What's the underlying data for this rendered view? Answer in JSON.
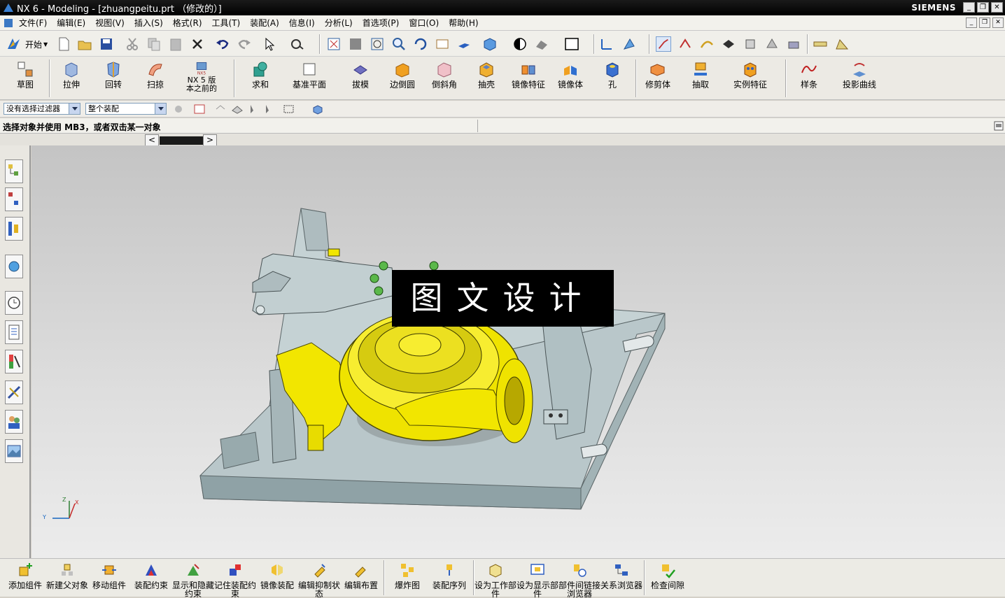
{
  "window": {
    "title": "NX 6 - Modeling - [zhuangpeitu.prt （修改的）]",
    "brand": "SIEMENS"
  },
  "menubar": [
    {
      "label": "文件(F)"
    },
    {
      "label": "编辑(E)"
    },
    {
      "label": "视图(V)"
    },
    {
      "label": "插入(S)"
    },
    {
      "label": "格式(R)"
    },
    {
      "label": "工具(T)"
    },
    {
      "label": "装配(A)"
    },
    {
      "label": "信息(I)"
    },
    {
      "label": "分析(L)"
    },
    {
      "label": "首选项(P)"
    },
    {
      "label": "窗口(O)"
    },
    {
      "label": "帮助(H)"
    }
  ],
  "toolbar1": {
    "start_label": "开始"
  },
  "features_toolbar": [
    {
      "label": "草图",
      "icon": "sketch-icon"
    },
    {
      "label": "拉伸",
      "icon": "extrude-icon"
    },
    {
      "label": "回转",
      "icon": "revolve-icon"
    },
    {
      "label": "扫掠",
      "icon": "sweep-icon"
    },
    {
      "label": "NX 5 版本之前的",
      "icon": "nx5-icon"
    },
    {
      "label": "求和",
      "icon": "unite-icon"
    },
    {
      "label": "基准平面",
      "icon": "datum-plane-icon"
    },
    {
      "label": "拔模",
      "icon": "draft-icon"
    },
    {
      "label": "边倒圆",
      "icon": "edge-blend-icon"
    },
    {
      "label": "倒斜角",
      "icon": "chamfer-icon"
    },
    {
      "label": "抽壳",
      "icon": "shell-icon"
    },
    {
      "label": "镜像特征",
      "icon": "mirror-feature-icon"
    },
    {
      "label": "镜像体",
      "icon": "mirror-body-icon"
    },
    {
      "label": "孔",
      "icon": "hole-icon"
    },
    {
      "label": "修剪体",
      "icon": "trim-body-icon"
    },
    {
      "label": "抽取",
      "icon": "extract-icon"
    },
    {
      "label": "实例特征",
      "icon": "instance-feature-icon"
    },
    {
      "label": "样条",
      "icon": "spline-icon"
    },
    {
      "label": "投影曲线",
      "icon": "project-curve-icon"
    }
  ],
  "filterbar": {
    "type_filter": "没有选择过滤器",
    "scope_filter": "整个装配"
  },
  "status": {
    "message": "选择对象并使用 MB3，或者双击某一对象"
  },
  "watermark": {
    "text": "图文设计"
  },
  "triad": {
    "x": "X",
    "y": "Y",
    "z": "Z"
  },
  "assembly_toolbar": [
    {
      "label": "添加组件"
    },
    {
      "label": "新建父对象"
    },
    {
      "label": "移动组件"
    },
    {
      "label": "装配约束"
    },
    {
      "label": "显示和隐藏约束"
    },
    {
      "label": "记住装配约束"
    },
    {
      "label": "镜像装配"
    },
    {
      "label": "编辑抑制状态"
    },
    {
      "label": "编辑布置"
    },
    {
      "label": "爆炸图"
    },
    {
      "label": "装配序列"
    },
    {
      "label": "设为工作部件"
    },
    {
      "label": "设为显示部件"
    },
    {
      "label": "部件间链接浏览器"
    },
    {
      "label": "关系浏览器"
    },
    {
      "label": "检查间隙"
    }
  ],
  "colors": {
    "part_yellow": "#f2e600",
    "fixture_gray": "#b8c6c9",
    "watermark_bg": "#000000"
  }
}
